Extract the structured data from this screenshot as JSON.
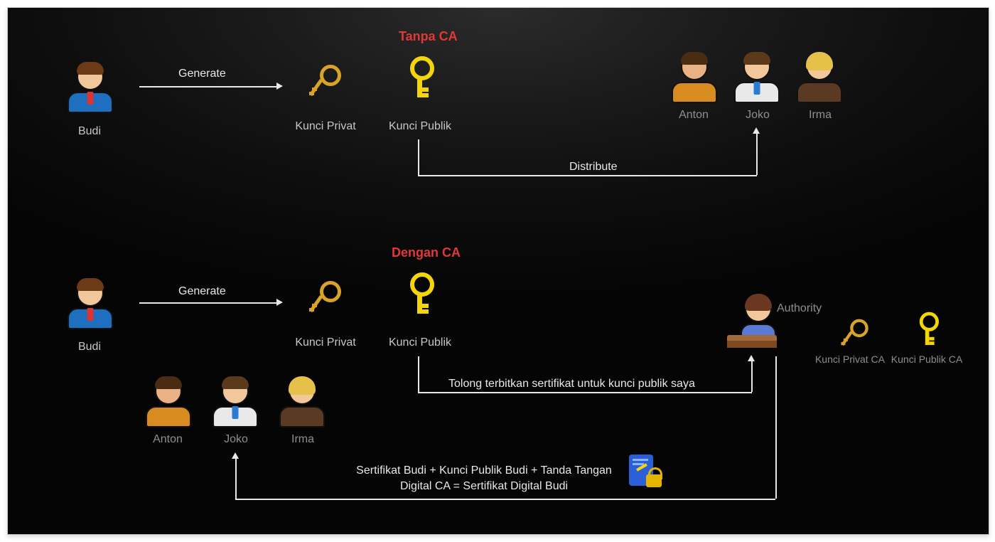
{
  "sections": {
    "top": {
      "title": "Tanpa CA"
    },
    "bottom": {
      "title": "Dengan CA"
    }
  },
  "actors": {
    "budi": "Budi",
    "anton": "Anton",
    "joko": "Joko",
    "irma": "Irma",
    "authority": "Authority"
  },
  "keys": {
    "private": "Kunci Privat",
    "public": "Kunci Publik",
    "ca_private": "Kunci Privat CA",
    "ca_public": "Kunci Publik CA"
  },
  "actions": {
    "generate": "Generate",
    "distribute": "Distribute",
    "request_cert": "Tolong terbitkan sertifikat untuk kunci publik saya",
    "return_cert": "Sertifikat Budi + Kunci Publik Budi  + Tanda Tangan Digital CA = Sertifikat Digital Budi"
  }
}
